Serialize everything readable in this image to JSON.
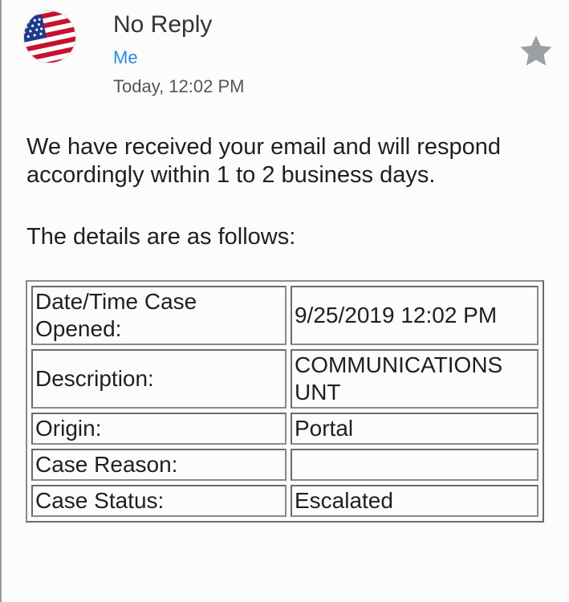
{
  "email": {
    "sender": "No Reply",
    "recipient": "Me",
    "timestamp": "Today, 12:02 PM",
    "avatar_icon": "us-flag-icon",
    "star_icon": "star-icon",
    "colors": {
      "recipient_link": "#2a8be0",
      "star": "#9aa0a6"
    }
  },
  "body": {
    "paragraph1": "We have received your email and will respond accordingly within 1 to 2 business days.",
    "paragraph2": "The details are as follows:"
  },
  "details": {
    "rows": [
      {
        "label": "Date/Time Case Opened:",
        "value": "9/25/2019 12:02 PM"
      },
      {
        "label": "Description:",
        "value": "COMMUNICATIONS UNT"
      },
      {
        "label": "Origin:",
        "value": "Portal"
      },
      {
        "label": "Case Reason:",
        "value": ""
      },
      {
        "label": "Case Status:",
        "value": "Escalated"
      }
    ]
  }
}
